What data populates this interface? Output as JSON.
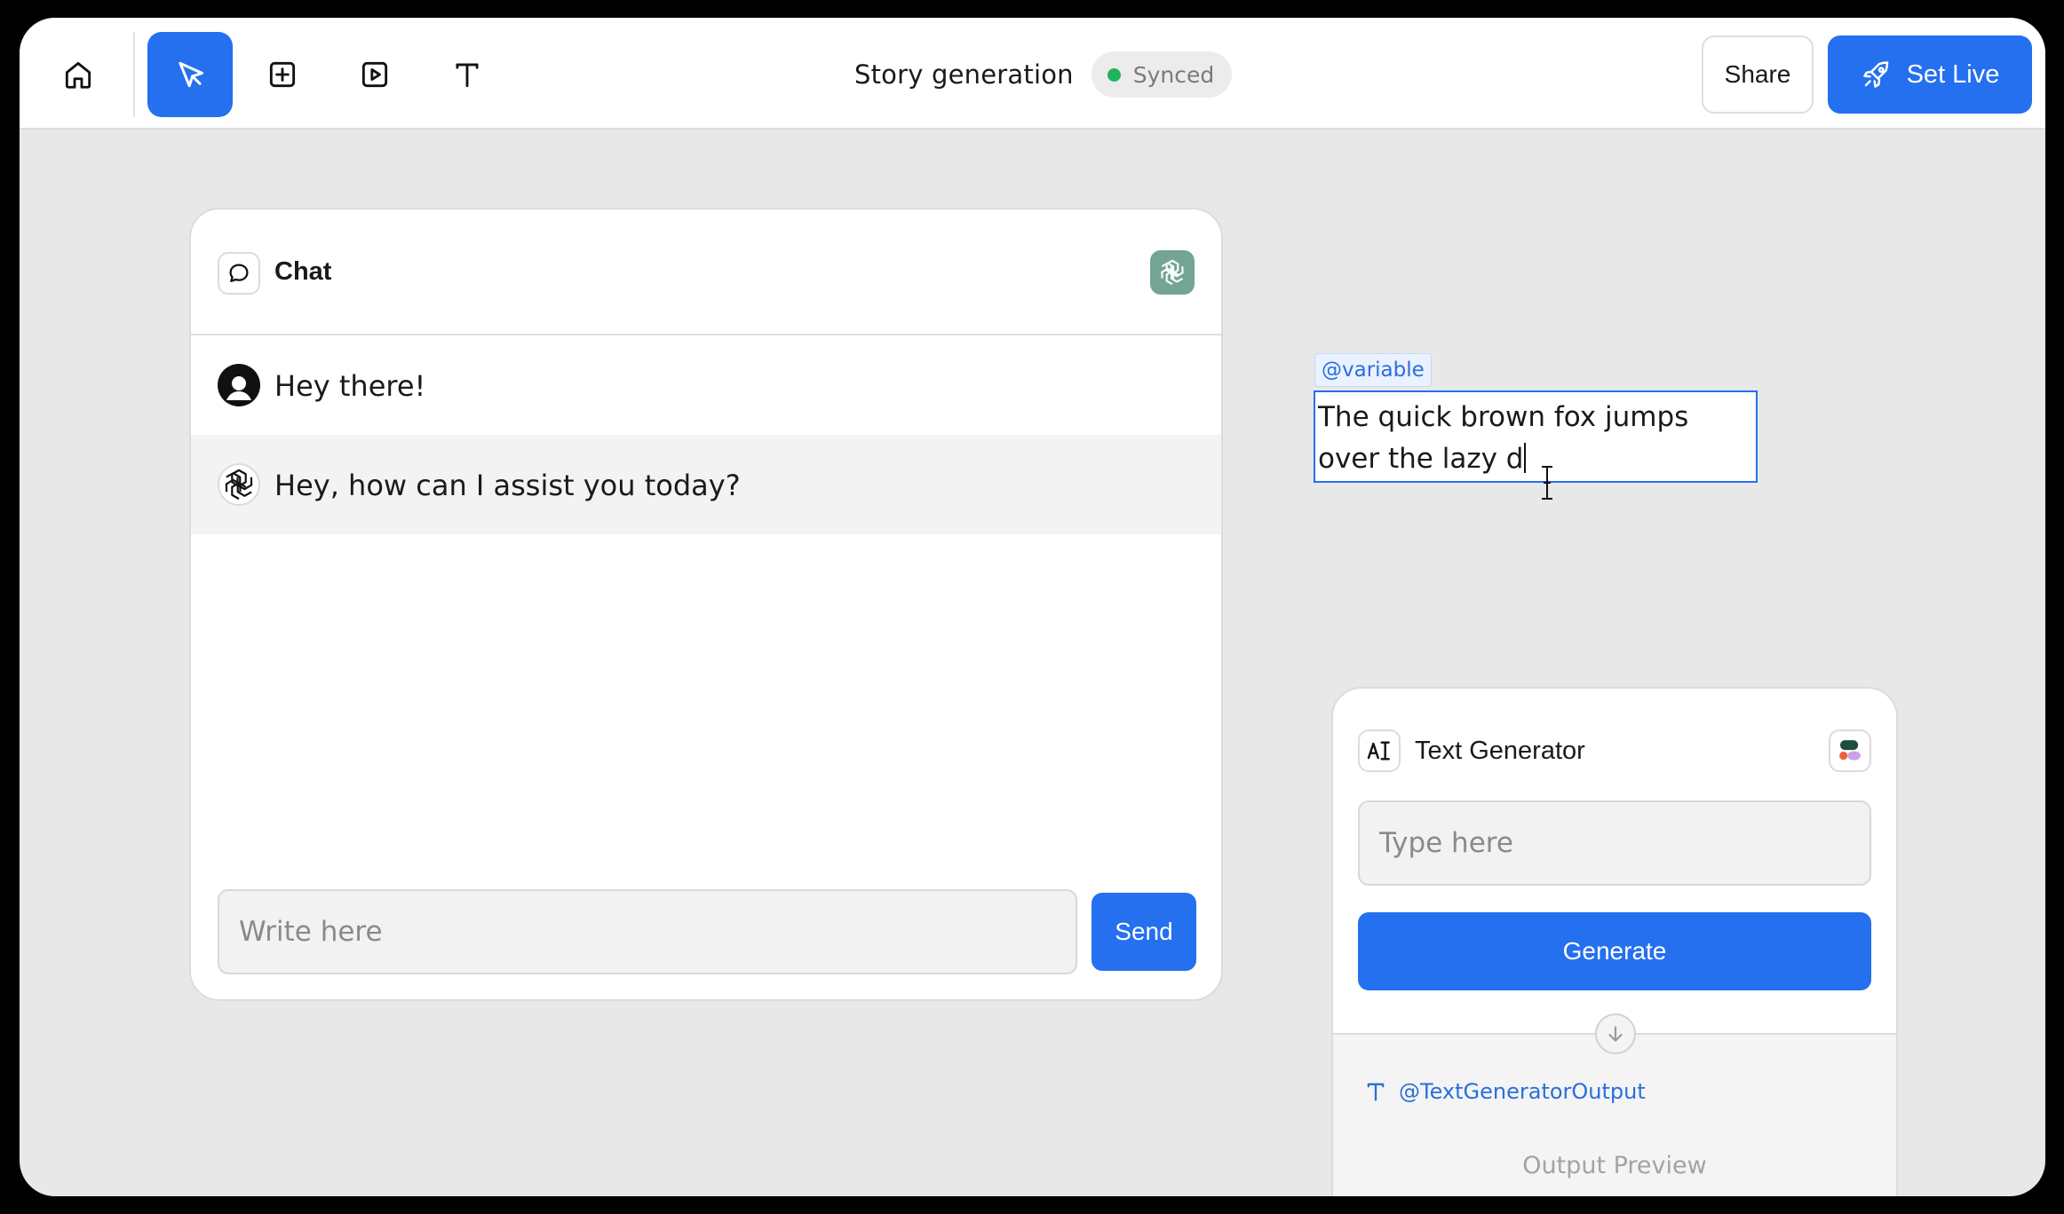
{
  "toolbar": {
    "tools": [
      {
        "name": "home-icon",
        "active": false
      },
      {
        "name": "cursor-pointer-icon",
        "active": true
      },
      {
        "name": "add-square-icon",
        "active": false
      },
      {
        "name": "play-square-icon",
        "active": false
      },
      {
        "name": "text-tool-icon",
        "active": false
      }
    ],
    "project_title": "Story generation",
    "sync_status": "Synced",
    "share_label": "Share",
    "set_live_label": "Set Live"
  },
  "chat_card": {
    "title": "Chat",
    "model_icon": "openai-icon",
    "messages": [
      {
        "role": "user",
        "text": "Hey there!"
      },
      {
        "role": "assistant",
        "text": "Hey, how can I assist you today?"
      }
    ],
    "input_placeholder": "Write here",
    "send_label": "Send"
  },
  "variable_note": {
    "tag": "@variable",
    "text": "The quick brown fox jumps over the lazy d"
  },
  "text_generator": {
    "title": "Text Generator",
    "input_placeholder": "Type here",
    "generate_label": "Generate",
    "output_variable": "@TextGeneratorOutput",
    "output_preview": "Output Preview"
  },
  "colors": {
    "accent": "#2470ef",
    "synced_dot": "#21b35b",
    "canvas": "#e8e8e8",
    "variable_text": "#2a6fdb"
  }
}
